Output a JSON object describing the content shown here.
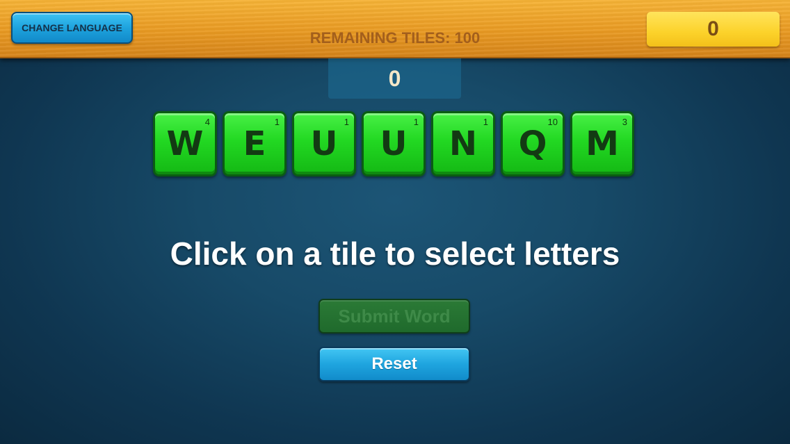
{
  "header": {
    "change_language_label": "CHANGE LANGUAGE",
    "remaining_tiles_label": "REMAINING TILES: 100",
    "total_score": "0"
  },
  "word_score": "0",
  "tiles": [
    {
      "letter": "W",
      "value": "4"
    },
    {
      "letter": "E",
      "value": "1"
    },
    {
      "letter": "U",
      "value": "1"
    },
    {
      "letter": "U",
      "value": "1"
    },
    {
      "letter": "N",
      "value": "1"
    },
    {
      "letter": "Q",
      "value": "10"
    },
    {
      "letter": "M",
      "value": "3"
    }
  ],
  "instruction": "Click on a tile to select letters",
  "buttons": {
    "submit_label": "Submit Word",
    "submit_enabled": false,
    "reset_label": "Reset"
  },
  "colors": {
    "tile_green": "#22d822",
    "button_blue": "#1fa5df",
    "score_yellow": "#fcd22a",
    "wood_orange": "#e99a22",
    "background_navy": "#174a68"
  }
}
